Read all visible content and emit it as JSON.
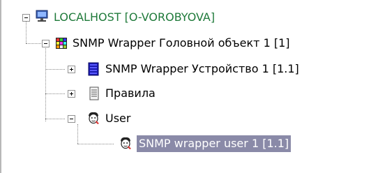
{
  "tree": {
    "root": {
      "label": "LOCALHOST [O-VOROBYOVA]",
      "icon": "computer-icon",
      "color": "#1f7a3a",
      "expanded": true
    },
    "snmp_object": {
      "label": "SNMP Wrapper Головной объект 1 [1]",
      "icon": "cube-grid-icon",
      "expanded": true
    },
    "device": {
      "label": "SNMP Wrapper Устройство  1 [1.1]",
      "icon": "device-icon",
      "expanded": false
    },
    "rules": {
      "label": "Правила",
      "icon": "rules-document-icon",
      "expanded": false
    },
    "user": {
      "label": "User",
      "icon": "user-face-icon",
      "expanded": true
    },
    "wrapper_user": {
      "label": "SNMP wrapper user 1 [1.1]",
      "icon": "user-face-icon",
      "selected": true,
      "selection_color": "#8a8aa8"
    }
  }
}
